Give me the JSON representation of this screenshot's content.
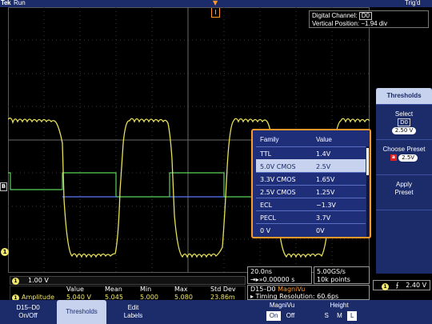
{
  "top_bar": {
    "brand": "Tek",
    "run_state": "Run",
    "trigger_state": "Trig'd",
    "trigger_marker": "T"
  },
  "digital_channel_box": {
    "label": "Digital Channel:",
    "value": "D0",
    "vertical_label": "Vertical Position:",
    "vertical_value": "−1.94 div"
  },
  "edge_markers": {
    "bus": "B",
    "channel1": "1"
  },
  "family_popup": {
    "headers": [
      "Family",
      "Value"
    ],
    "rows": [
      {
        "family": "TTL",
        "value": "1.4V"
      },
      {
        "family": "5.0V CMOS",
        "value": "2.5V",
        "selected": true
      },
      {
        "family": "3.3V CMOS",
        "value": "1.65V"
      },
      {
        "family": "2.5V CMOS",
        "value": "1.25V"
      },
      {
        "family": "ECL",
        "value": "−1.3V"
      },
      {
        "family": "PECL",
        "value": "3.7V"
      },
      {
        "family": "0 V",
        "value": "0V"
      }
    ]
  },
  "side_menu": {
    "title": "Thresholds",
    "select_label": "Select",
    "select_channel": "D0",
    "select_value": "2.50 V",
    "preset_label": "Choose Preset",
    "preset_knob": "a",
    "preset_value": "2.5V",
    "apply_line1": "Apply",
    "apply_line2": "Preset"
  },
  "status": {
    "ch1_num": "1",
    "ch1_scale": "1.00 V",
    "meas_headers": [
      "Value",
      "Mean",
      "Min",
      "Max",
      "Std Dev"
    ],
    "meas_name": "Amplitude",
    "meas_values": [
      "5.040 V",
      "5.045",
      "5.000",
      "5.080",
      "23.86m"
    ],
    "timebase": "20.0ns",
    "trigger_pos": "⇥▸»0.00000 s",
    "sample_rate": "5.00GS/s",
    "record_length": "10k points",
    "mag_line1_prefix": "D15–D0 ",
    "mag_line1_accent": "MagniVu",
    "mag_line2": "▸ Timing Resolution: 60.6ps",
    "trig_channel": "1",
    "trig_slope": "⨍",
    "trig_level": "2.40 V"
  },
  "bottom_menu": {
    "d15_line1": "D15–D0",
    "d15_line2": "On/Off",
    "thresholds": "Thresholds",
    "edit_line1": "Edit",
    "edit_line2": "Labels",
    "magnivu": "MagniVu",
    "on": "On",
    "off": "Off",
    "height": "Height",
    "height_opts": [
      "S",
      "M",
      "L"
    ]
  },
  "colors": {
    "trace_analog": "#e8e05a",
    "trace_digital_high": "#5ad35a",
    "trace_digital_low": "#5a78ff",
    "menu_blue": "#1c2c6a",
    "highlight": "#ff9a2a"
  },
  "icons": [
    "trigger-marker-icon",
    "slope-rising-icon",
    "knob-a-icon"
  ]
}
